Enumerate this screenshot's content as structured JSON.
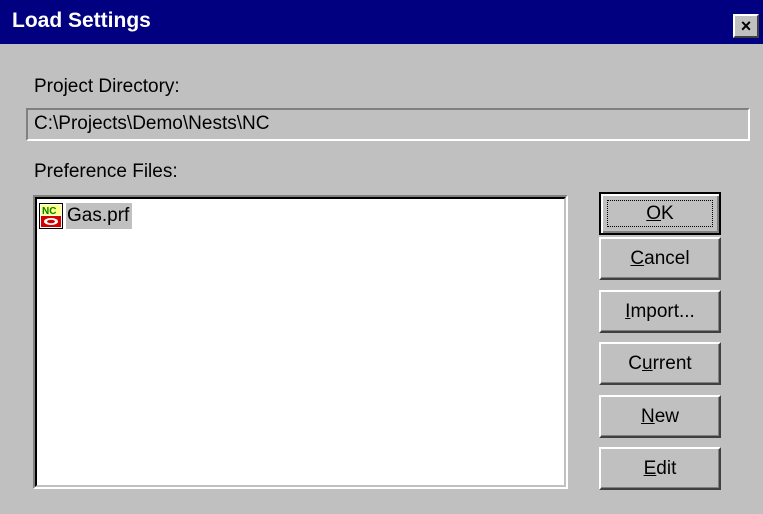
{
  "window": {
    "title": "Load Settings",
    "close_glyph": "×",
    "close_icon": "close-icon"
  },
  "project_directory": {
    "label": "Project Directory:",
    "value": "C:\\Projects\\Demo\\Nests\\NC"
  },
  "preference_files": {
    "label": "Preference Files:",
    "items": [
      {
        "name": "Gas.prf",
        "icon": "nc-file-icon",
        "selected": true
      }
    ]
  },
  "buttons": {
    "ok": {
      "accel": "O",
      "rest": "K"
    },
    "cancel": {
      "accel": "C",
      "rest": "ancel"
    },
    "import": {
      "accel": "I",
      "rest": "mport..."
    },
    "current": {
      "pre": "C",
      "accel": "u",
      "rest": "rrent"
    },
    "new": {
      "accel": "N",
      "rest": "ew"
    },
    "edit": {
      "accel": "E",
      "rest": "dit"
    }
  },
  "colors": {
    "titlebar": "#000080",
    "face": "#c0c0c0",
    "icon_red": "#d40000"
  }
}
